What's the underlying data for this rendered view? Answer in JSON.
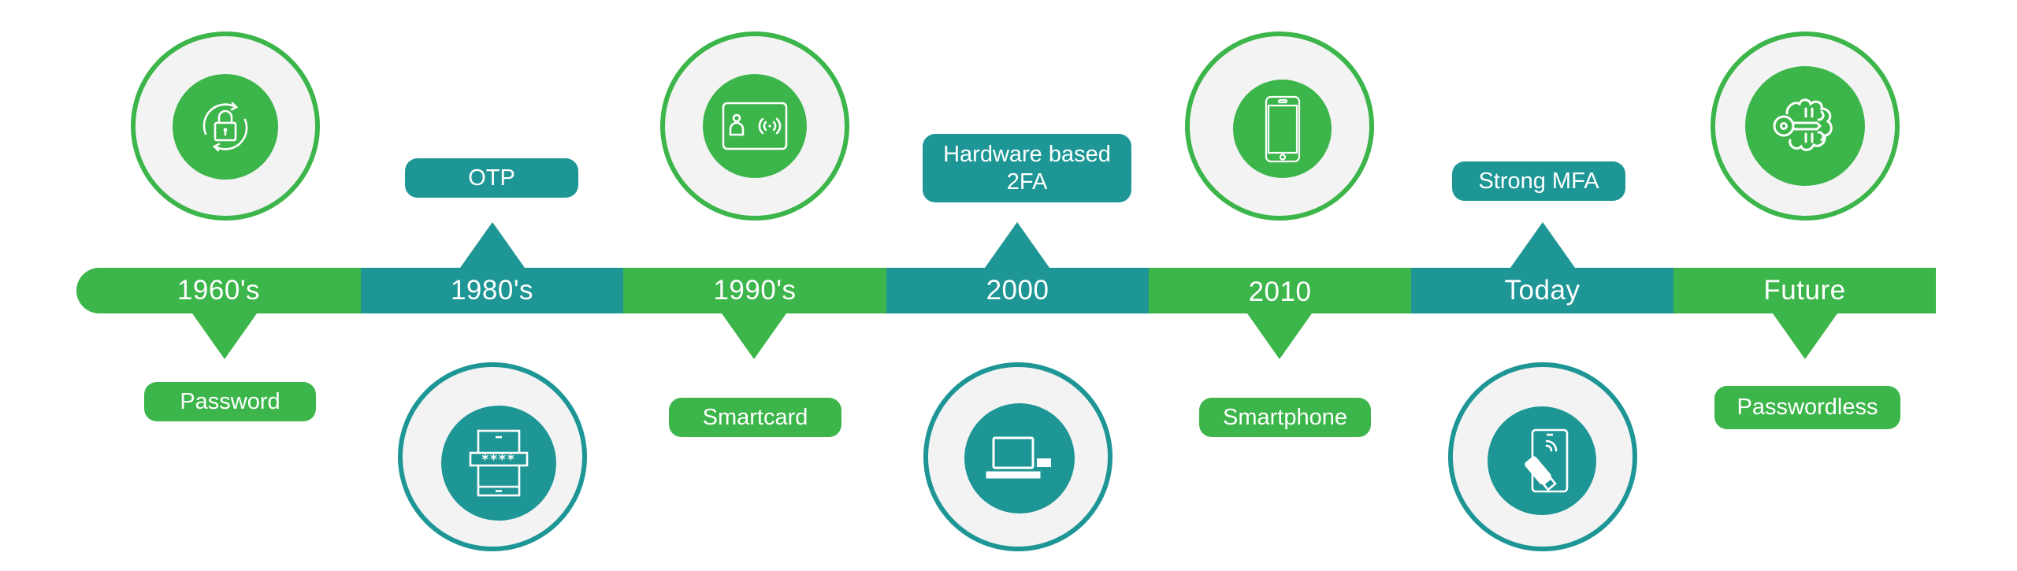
{
  "colors": {
    "green": "#3cb54a",
    "teal": "#1e9696",
    "ring_fill": "#f3f3f3"
  },
  "timeline": [
    {
      "era": "1960's",
      "label": "Password",
      "icon": "lock-rotate-icon",
      "color": "green",
      "side": "top-icon"
    },
    {
      "era": "1980's",
      "label": "OTP",
      "icon": "phone-pin-icon",
      "color": "teal",
      "side": "bottom-icon"
    },
    {
      "era": "1990's",
      "label": "Smartcard",
      "icon": "id-card-contactless-icon",
      "color": "green",
      "side": "top-icon"
    },
    {
      "era": "2000",
      "label": "Hardware based 2FA",
      "label_line1": "Hardware based",
      "label_line2": "2FA",
      "icon": "laptop-token-icon",
      "color": "teal",
      "side": "bottom-icon"
    },
    {
      "era": "2010",
      "label": "Smartphone",
      "icon": "smartphone-icon",
      "color": "green",
      "side": "top-icon"
    },
    {
      "era": "Today",
      "label": "Strong MFA",
      "icon": "security-key-phone-icon",
      "color": "teal",
      "side": "bottom-icon"
    },
    {
      "era": "Future",
      "label": "Passwordless",
      "icon": "brain-key-icon",
      "color": "green",
      "side": "top-icon"
    }
  ]
}
